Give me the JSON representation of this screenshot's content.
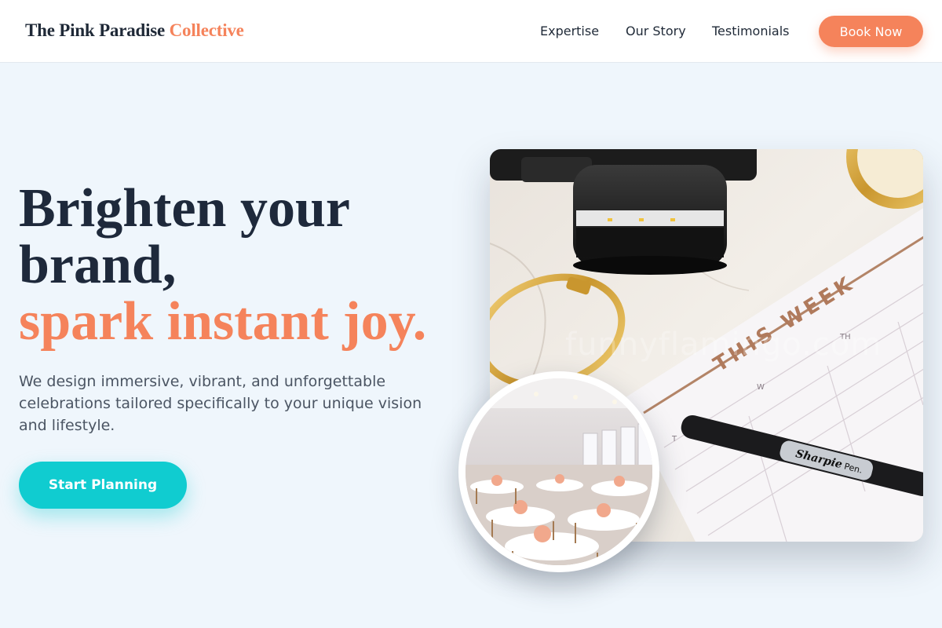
{
  "header": {
    "logo_main": "The Pink Paradise",
    "logo_accent": "Collective",
    "nav": [
      "Expertise",
      "Our Story",
      "Testimonials"
    ],
    "cta_label": "Book Now"
  },
  "hero": {
    "headline_line1": "Brighten your",
    "headline_line2": "brand,",
    "headline_accent": "spark instant joy.",
    "subtext": "We design immersive, vibrant, and unforgettable celebrations tailored specifically to your unique vision and lifestyle.",
    "cta_label": "Start Planning"
  },
  "image": {
    "planner_heading": "THIS WEEK",
    "pen_brand": "Sharpie",
    "pen_label": "Pen.",
    "day_labels": [
      "W",
      "TH",
      "T"
    ],
    "watermark": "funnyflamingo.com"
  },
  "colors": {
    "accent": "#f5835b",
    "cta": "#10ccd0",
    "text_dark": "#1e293b",
    "background": "#eff6fc"
  }
}
